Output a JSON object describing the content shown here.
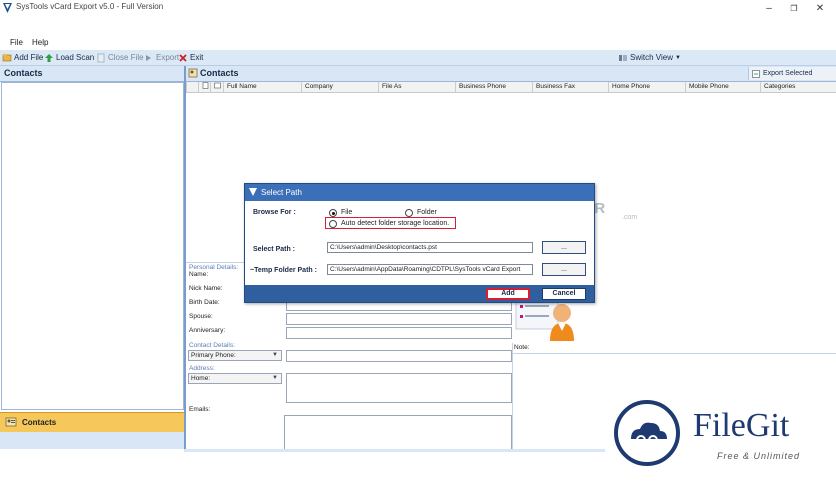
{
  "window": {
    "title": "SysTools vCard Export v5.0 - Full Version",
    "minimize_glyph": "–",
    "restore_glyph": "❐",
    "close_glyph": "✕"
  },
  "menu": {
    "file": "File",
    "help": "Help"
  },
  "toolbar": {
    "add_file": "Add File",
    "load_scan": "Load Scan",
    "close_file": "Close File",
    "export": "Export",
    "exit": "Exit",
    "switch_view": "Switch View"
  },
  "left_pane": {
    "header": "Contacts",
    "bottom_button": "Contacts",
    "splitter": "....."
  },
  "right_pane": {
    "header": "Contacts",
    "export_selected": "Export Selected",
    "columns": [
      "Full Name",
      "Company",
      "File As",
      "Business Phone",
      "Business Fax",
      "Home Phone",
      "Mobile Phone",
      "Categories"
    ]
  },
  "details": {
    "personal_section": "Personal Details:",
    "name_label": "Name:",
    "nickname_label": "Nick Name:",
    "birthdate_label": "Birth Date:",
    "spouse_label": "Spouse:",
    "anniversary_label": "Anniversary:",
    "contact_section": "Contact Details:",
    "primary_phone": "Primary Phone:",
    "address_section": "Address:",
    "home": "Home:",
    "emails_label": "Emails:",
    "note_label": "Note:"
  },
  "dialog": {
    "title": "Select Path",
    "browse_for": "Browse For :",
    "option_file": "File",
    "option_folder": "Folder",
    "auto_detect": "Auto detect folder storage location.",
    "select_path_label": "Select Path :",
    "select_path_value": "C:\\Users\\admin\\Desktop\\contacts.pst",
    "temp_folder_label": "~Temp Folder Path :",
    "temp_folder_value": "C:\\Users\\admin\\AppData\\Roaming\\CDTPL\\SysTools  vCard Export",
    "browse_button": "...",
    "add_button": "Add",
    "cancel_button": "Cancel"
  },
  "watermarks": {
    "filecr": "FILECR",
    "filecr_suffix": ".com",
    "filegit": "FileGit",
    "filegit_tagline": "Free & Unlimited"
  },
  "colors": {
    "toolbar_bg": "#dbe8f6",
    "dialog_header": "#3b6fb7",
    "dialog_footer": "#2f5f9f",
    "left_contacts_button": "#f6c75a",
    "highlight_red": "#d42035"
  }
}
